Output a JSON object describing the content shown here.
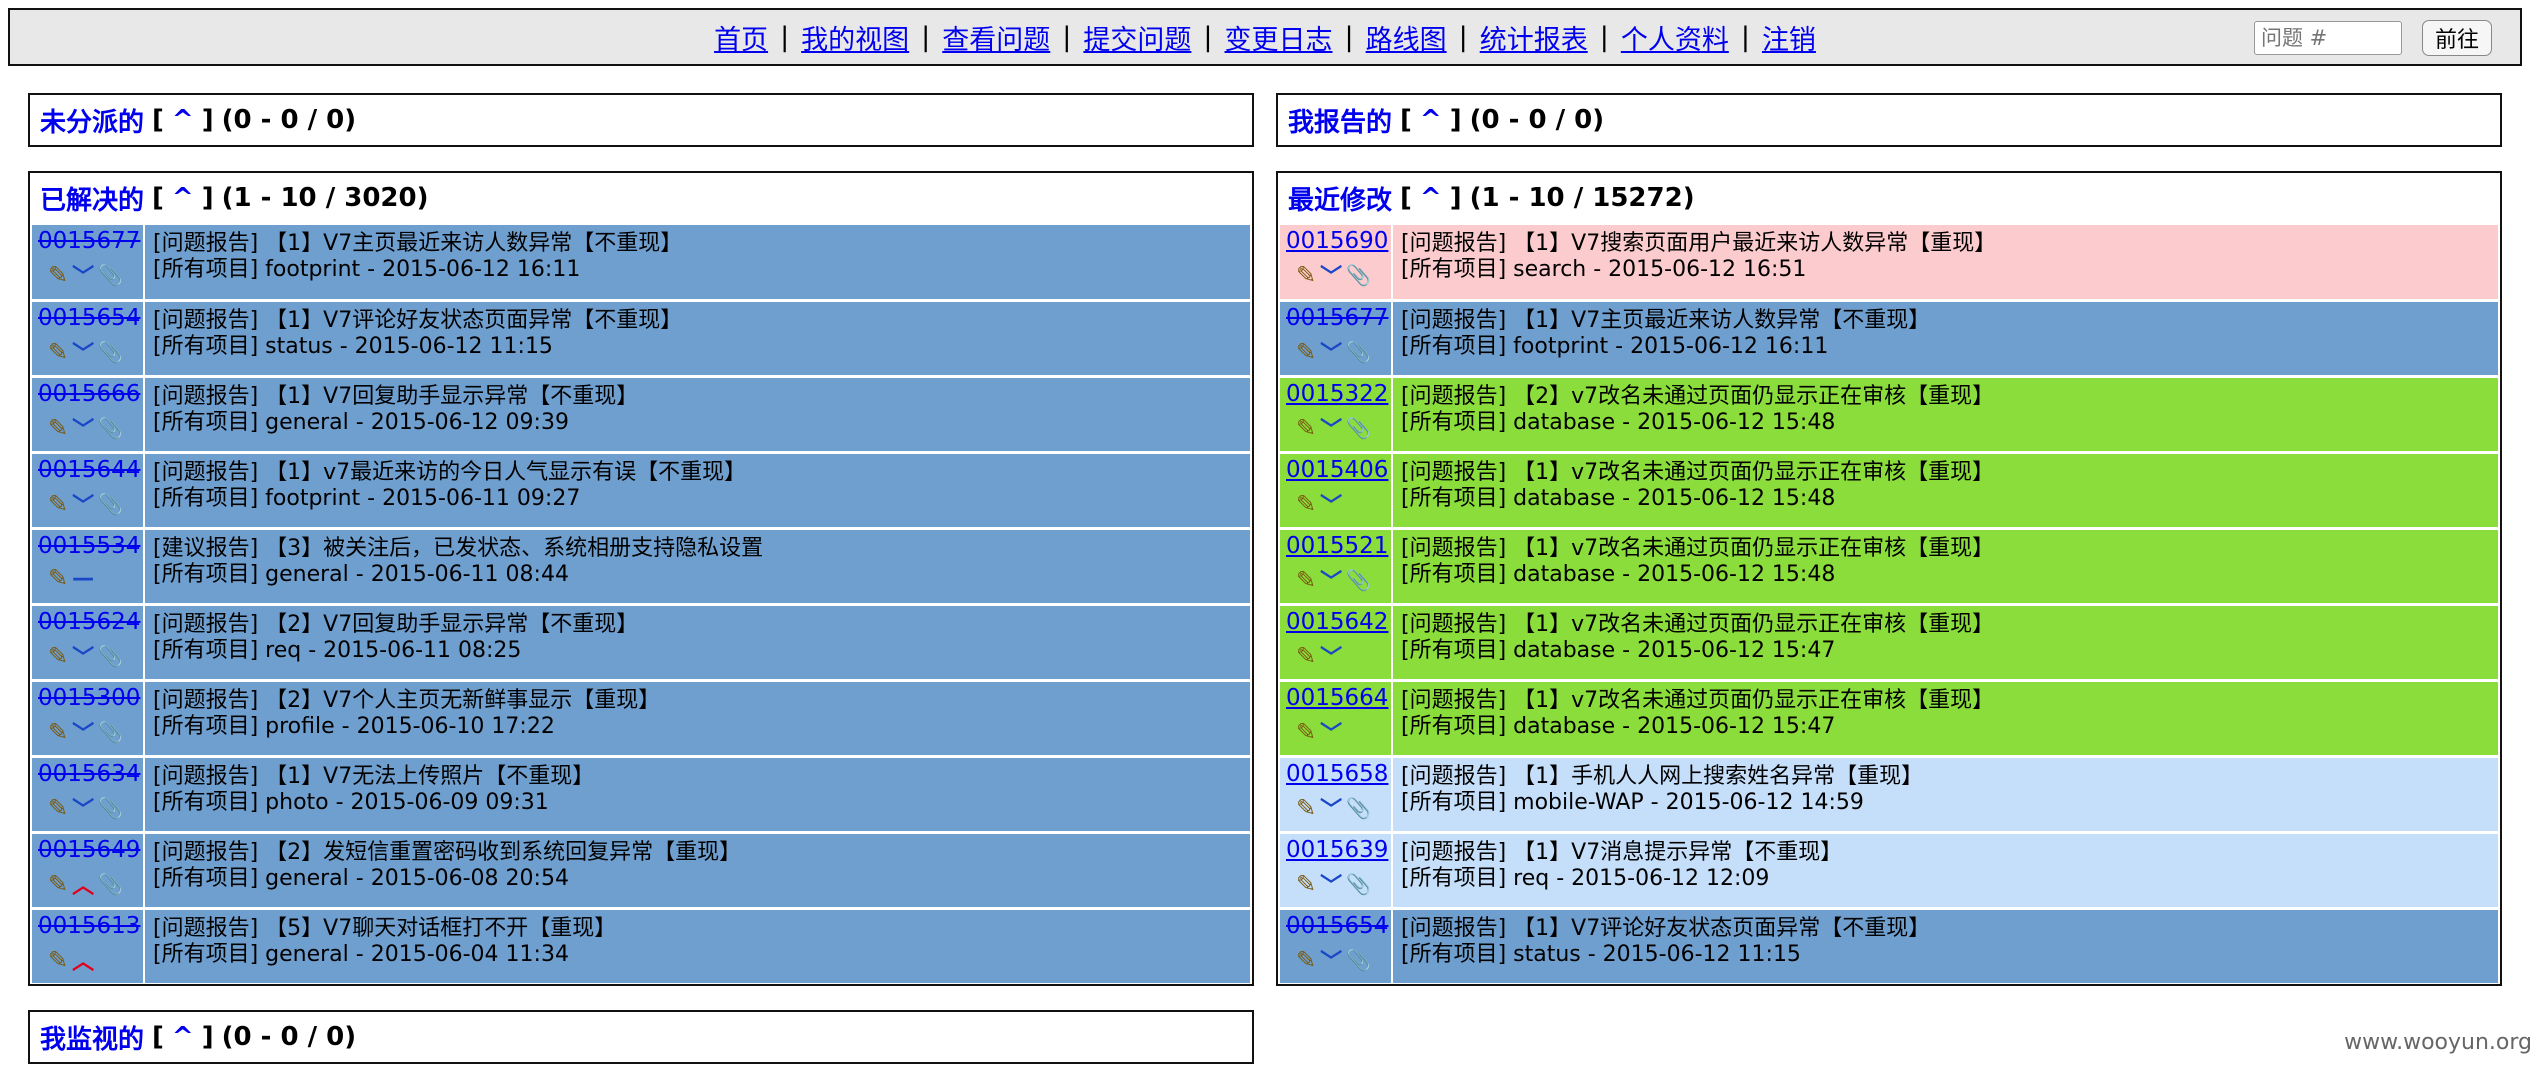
{
  "nav": {
    "items": [
      "首页",
      "我的视图",
      "查看问题",
      "提交问题",
      "变更日志",
      "路线图",
      "统计报表",
      "个人资料",
      "注销"
    ],
    "separator": "|",
    "jump_placeholder": "问题 #",
    "jump_button": "前往"
  },
  "boxes": {
    "unassigned": {
      "title": "未分派的",
      "up": "^",
      "bracket_open": "[",
      "bracket_close": "]",
      "range": "(0 - 0 / 0)"
    },
    "reported": {
      "title": "我报告的",
      "up": "^",
      "bracket_open": "[",
      "bracket_close": "]",
      "range": "(0 - 0 / 0)"
    },
    "resolved": {
      "title": "已解决的",
      "up": "^",
      "bracket_open": "[",
      "bracket_close": "]",
      "range": "(1 - 10 / 3020)"
    },
    "recent": {
      "title": "最近修改",
      "up": "^",
      "bracket_open": "[",
      "bracket_close": "]",
      "range": "(1 - 10 / 15272)"
    },
    "monitored": {
      "title": "我监视的",
      "up": "^",
      "bracket_open": "[",
      "bracket_close": "]",
      "range": "(0 - 0 / 0)"
    }
  },
  "status_colors": {
    "resolved": "#6f9fcf",
    "new": "#fccbcd",
    "confirmed": "#8add3b",
    "acknowledged": "#c5dffb"
  },
  "icon_names": {
    "edit": "pencil-icon",
    "priority_low": "chevron-down-icon",
    "priority_high": "chevron-up-icon",
    "priority_normal": "dash-icon",
    "attachment": "paperclip-icon"
  },
  "resolved_rows": [
    {
      "id": "0015677",
      "line1": "[问题报告] 【1】V7主页最近来访人数异常【不重现】",
      "line2": "[所有项目] footprint - 2015-06-12 16:11",
      "status": "resolved",
      "priority": "low",
      "attachment": true
    },
    {
      "id": "0015654",
      "line1": "[问题报告] 【1】V7评论好友状态页面异常【不重现】",
      "line2": "[所有项目] status - 2015-06-12 11:15",
      "status": "resolved",
      "priority": "low",
      "attachment": true
    },
    {
      "id": "0015666",
      "line1": "[问题报告] 【1】V7回复助手显示异常【不重现】",
      "line2": "[所有项目] general - 2015-06-12 09:39",
      "status": "resolved",
      "priority": "low",
      "attachment": true
    },
    {
      "id": "0015644",
      "line1": "[问题报告] 【1】v7最近来访的今日人气显示有误【不重现】",
      "line2": "[所有项目] footprint - 2015-06-11 09:27",
      "status": "resolved",
      "priority": "low",
      "attachment": true
    },
    {
      "id": "0015534",
      "line1": "[建议报告] 【3】被关注后，已发状态、系统相册支持隐私设置",
      "line2": "[所有项目] general - 2015-06-11 08:44",
      "status": "resolved",
      "priority": "normal",
      "attachment": false
    },
    {
      "id": "0015624",
      "line1": "[问题报告] 【2】V7回复助手显示异常【不重现】",
      "line2": "[所有项目] req - 2015-06-11 08:25",
      "status": "resolved",
      "priority": "low",
      "attachment": true
    },
    {
      "id": "0015300",
      "line1": "[问题报告] 【2】V7个人主页无新鲜事显示【重现】",
      "line2": "[所有项目] profile - 2015-06-10 17:22",
      "status": "resolved",
      "priority": "low",
      "attachment": true
    },
    {
      "id": "0015634",
      "line1": "[问题报告] 【1】V7无法上传照片【不重现】",
      "line2": "[所有项目] photo - 2015-06-09 09:31",
      "status": "resolved",
      "priority": "low",
      "attachment": true
    },
    {
      "id": "0015649",
      "line1": "[问题报告] 【2】发短信重置密码收到系统回复异常【重现】",
      "line2": "[所有项目] general - 2015-06-08 20:54",
      "status": "resolved",
      "priority": "high",
      "attachment": true
    },
    {
      "id": "0015613",
      "line1": "[问题报告] 【5】V7聊天对话框打不开【重现】",
      "line2": "[所有项目] general - 2015-06-04 11:34",
      "status": "resolved",
      "priority": "high",
      "attachment": false
    }
  ],
  "recent_rows": [
    {
      "id": "0015690",
      "line1": "[问题报告] 【1】V7搜索页面用户最近来访人数异常【重现】",
      "line2": "[所有项目] search - 2015-06-12 16:51",
      "status": "new",
      "priority": "low",
      "attachment": true,
      "strike": false
    },
    {
      "id": "0015677",
      "line1": "[问题报告] 【1】V7主页最近来访人数异常【不重现】",
      "line2": "[所有项目] footprint - 2015-06-12 16:11",
      "status": "resolved",
      "priority": "low",
      "attachment": true,
      "strike": true
    },
    {
      "id": "0015322",
      "line1": "[问题报告] 【2】v7改名未通过页面仍显示正在审核【重现】",
      "line2": "[所有项目] database - 2015-06-12 15:48",
      "status": "confirmed",
      "priority": "low",
      "attachment": true,
      "strike": false
    },
    {
      "id": "0015406",
      "line1": "[问题报告] 【1】v7改名未通过页面仍显示正在审核【重现】",
      "line2": "[所有项目] database - 2015-06-12 15:48",
      "status": "confirmed",
      "priority": "low",
      "attachment": false,
      "strike": false
    },
    {
      "id": "0015521",
      "line1": "[问题报告] 【1】v7改名未通过页面仍显示正在审核【重现】",
      "line2": "[所有项目] database - 2015-06-12 15:48",
      "status": "confirmed",
      "priority": "low",
      "attachment": true,
      "strike": false
    },
    {
      "id": "0015642",
      "line1": "[问题报告] 【1】v7改名未通过页面仍显示正在审核【重现】",
      "line2": "[所有项目] database - 2015-06-12 15:47",
      "status": "confirmed",
      "priority": "low",
      "attachment": false,
      "strike": false
    },
    {
      "id": "0015664",
      "line1": "[问题报告] 【1】v7改名未通过页面仍显示正在审核【重现】",
      "line2": "[所有项目] database - 2015-06-12 15:47",
      "status": "confirmed",
      "priority": "low",
      "attachment": false,
      "strike": false
    },
    {
      "id": "0015658",
      "line1": "[问题报告] 【1】手机人人网上搜索姓名异常【重现】",
      "line2": "[所有项目] mobile-WAP - 2015-06-12 14:59",
      "status": "acknowledged",
      "priority": "low",
      "attachment": true,
      "strike": false
    },
    {
      "id": "0015639",
      "line1": "[问题报告] 【1】V7消息提示异常【不重现】",
      "line2": "[所有项目] req - 2015-06-12 12:09",
      "status": "acknowledged",
      "priority": "low",
      "attachment": true,
      "strike": false
    },
    {
      "id": "0015654",
      "line1": "[问题报告] 【1】V7评论好友状态页面异常【不重现】",
      "line2": "[所有项目] status - 2015-06-12 11:15",
      "status": "resolved",
      "priority": "low",
      "attachment": true,
      "strike": true
    }
  ],
  "watermark": "www.wooyun.org"
}
